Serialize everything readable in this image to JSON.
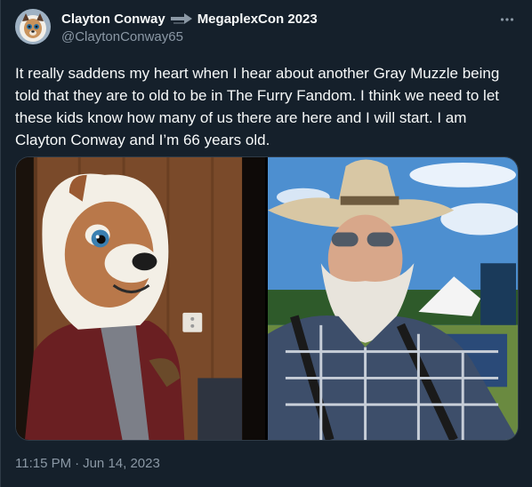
{
  "author": {
    "display_name": "Clayton Conway",
    "event_name": "MegaplexCon 2023",
    "handle": "@ClaytonConway65",
    "avatar": "furry-fursuit-avatar"
  },
  "tweet": {
    "text": "It really saddens my heart when I hear about another Gray Muzzle being told that they are to old to be in The Furry Fandom. I think we need to let these kids know how many of us there are here and I will start. I am Clayton Conway and I’m 66 years old.",
    "time": "11:15 PM",
    "separator": "·",
    "date": "Jun 14, 2023"
  },
  "media": {
    "photos": [
      {
        "description_icon": "fursuit-lion-photo"
      },
      {
        "description_icon": "man-cowboy-hat-photo"
      }
    ]
  },
  "icons": {
    "more": "more-icon",
    "arrow": "arrow-right-icon"
  },
  "colors": {
    "background": "#15202b",
    "text_primary": "#f7f9f9",
    "text_secondary": "#8b98a5",
    "border": "#2f3b47"
  }
}
